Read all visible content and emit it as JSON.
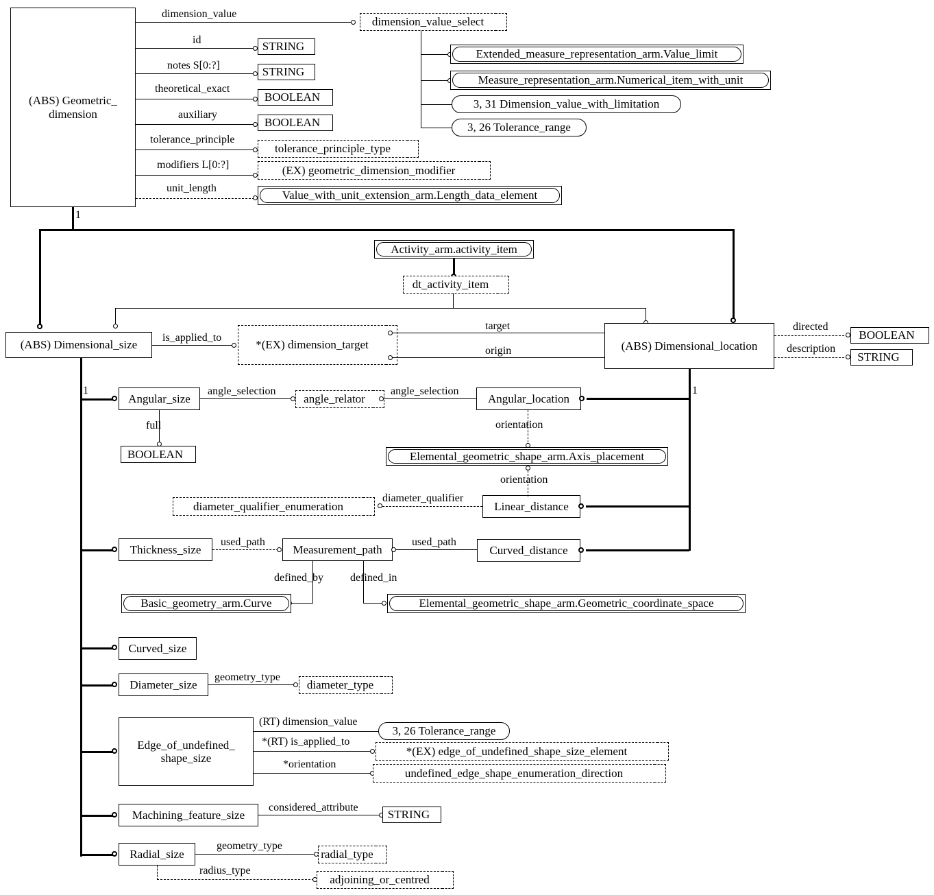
{
  "diagram": {
    "title": "EXPRESS-G dimension schema diagram",
    "type": "express-g"
  },
  "entities": {
    "geometric_dimension": "(ABS) Geometric_\ndimension",
    "geometric_dimension_l1": "(ABS) Geometric_",
    "geometric_dimension_l2": "dimension",
    "dimensional_size": "(ABS) Dimensional_size",
    "dimensional_location": "(ABS) Dimensional_location",
    "angular_size": "Angular_size",
    "angular_location": "Angular_location",
    "linear_distance": "Linear_distance",
    "curved_distance": "Curved_distance",
    "thickness_size": "Thickness_size",
    "measurement_path": "Measurement_path",
    "curved_size": "Curved_size",
    "diameter_size": "Diameter_size",
    "edge_of_undefined_shape_size_l1": "Edge_of_undefined_",
    "edge_of_undefined_shape_size_l2": "shape_size",
    "machining_feature_size": "Machining_feature_size",
    "radial_size": "Radial_size"
  },
  "selects": {
    "dimension_value_select": "dimension_value_select",
    "dt_activity_item": "dt_activity_item",
    "dimension_target": "*(EX) dimension_target",
    "angle_relator": "angle_relator",
    "tolerance_principle_type": "tolerance_principle_type",
    "geometric_dimension_modifier": "(EX) geometric_dimension_modifier",
    "diameter_qualifier_enumeration": "diameter_qualifier_enumeration",
    "diameter_type": "diameter_type",
    "edge_of_undefined_shape_size_element": "*(EX) edge_of_undefined_shape_size_element",
    "undefined_edge_shape_enumeration_direction": "undefined_edge_shape_enumeration_direction",
    "radial_type": "radial_type",
    "adjoining_or_centred": "adjoining_or_centred"
  },
  "imported": {
    "value_limit": "Extended_measure_representation_arm.Value_limit",
    "numerical_item_with_unit": "Measure_representation_arm.Numerical_item_with_unit",
    "length_data_element": "Value_with_unit_extension_arm.Length_data_element",
    "activity_item": "Activity_arm.activity_item",
    "axis_placement": "Elemental_geometric_shape_arm.Axis_placement",
    "curve": "Basic_geometry_arm.Curve",
    "geometric_coordinate_space": "Elemental_geometric_shape_arm.Geometric_coordinate_space"
  },
  "pagerefs": {
    "dimension_value_with_limitation": "3, 31 Dimension_value_with_limitation",
    "tolerance_range_top": "3, 26 Tolerance_range",
    "tolerance_range_bottom": "3, 26 Tolerance_range"
  },
  "simple_types": {
    "string_id": "STRING",
    "string_notes": "STRING",
    "boolean_theoretical_exact": "BOOLEAN",
    "boolean_auxiliary": "BOOLEAN",
    "boolean_full": "BOOLEAN",
    "boolean_directed": "BOOLEAN",
    "string_description": "STRING",
    "string_considered_attribute": "STRING"
  },
  "attribute_labels": {
    "dimension_value": "dimension_value",
    "id": "id",
    "notes": "notes S[0:?]",
    "theoretical_exact": "theoretical_exact",
    "auxiliary": "auxiliary",
    "tolerance_principle": "tolerance_principle",
    "modifiers": "modifiers L[0:?]",
    "unit_length": "unit_length",
    "is_applied_to": "is_applied_to",
    "target": "target",
    "origin": "origin",
    "directed": "directed",
    "description": "description",
    "angle_selection_left": "angle_selection",
    "angle_selection_right": "angle_selection",
    "full": "full",
    "orientation_top": "orientation",
    "orientation_bottom": "orientation",
    "diameter_qualifier": "diameter_qualifier",
    "used_path_left": "used_path",
    "used_path_right": "used_path",
    "defined_by": "defined_by",
    "defined_in": "defined_in",
    "geometry_type_diameter": "geometry_type",
    "rt_dimension_value": "(RT) dimension_value",
    "rt_is_applied_to": "*(RT) is_applied_to",
    "orientation_star": "*orientation",
    "considered_attribute": "considered_attribute",
    "geometry_type_radial": "geometry_type",
    "radius_type": "radius_type"
  },
  "cardinalities": {
    "geometric_dimension_one": "1",
    "dimensional_size_one": "1",
    "dimensional_location_one": "1"
  },
  "colors": {
    "line": "#000000",
    "background": "#ffffff",
    "text": "#000000"
  }
}
